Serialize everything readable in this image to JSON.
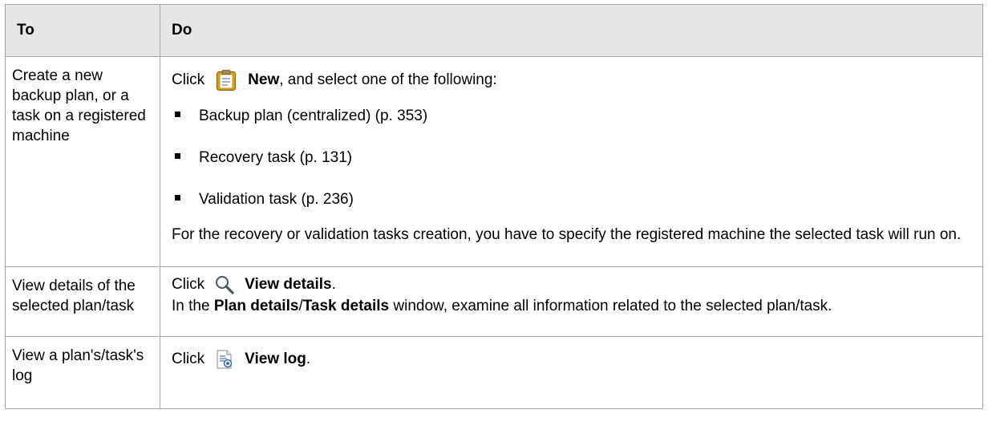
{
  "table": {
    "headers": {
      "to": "To",
      "do": "Do"
    },
    "rows": [
      {
        "to": "Create a new backup plan, or a task on a registered machine",
        "click_prefix": "Click",
        "action": "New",
        "action_suffix": ", and select one of the following:",
        "icon": "new-clipboard-icon",
        "options": [
          "Backup plan (centralized) (p. 353)",
          "Recovery task (p. 131)",
          "Validation task (p. 236)"
        ],
        "note": "For the recovery or validation tasks creation, you have to specify the registered machine the selected task will run on."
      },
      {
        "to": "View details of the selected plan/task",
        "click_prefix": "Click",
        "action": "View details",
        "action_suffix": ".",
        "icon": "magnifier-icon",
        "detail_prefix": "In the",
        "window_a": "Plan details",
        "slash": "/",
        "window_b": "Task details",
        "detail_suffix": "window, examine all information related to the selected plan/task."
      },
      {
        "to": "View a plan's/task's log",
        "click_prefix": "Click",
        "action": "View log",
        "action_suffix": ".",
        "icon": "view-log-icon"
      }
    ]
  }
}
